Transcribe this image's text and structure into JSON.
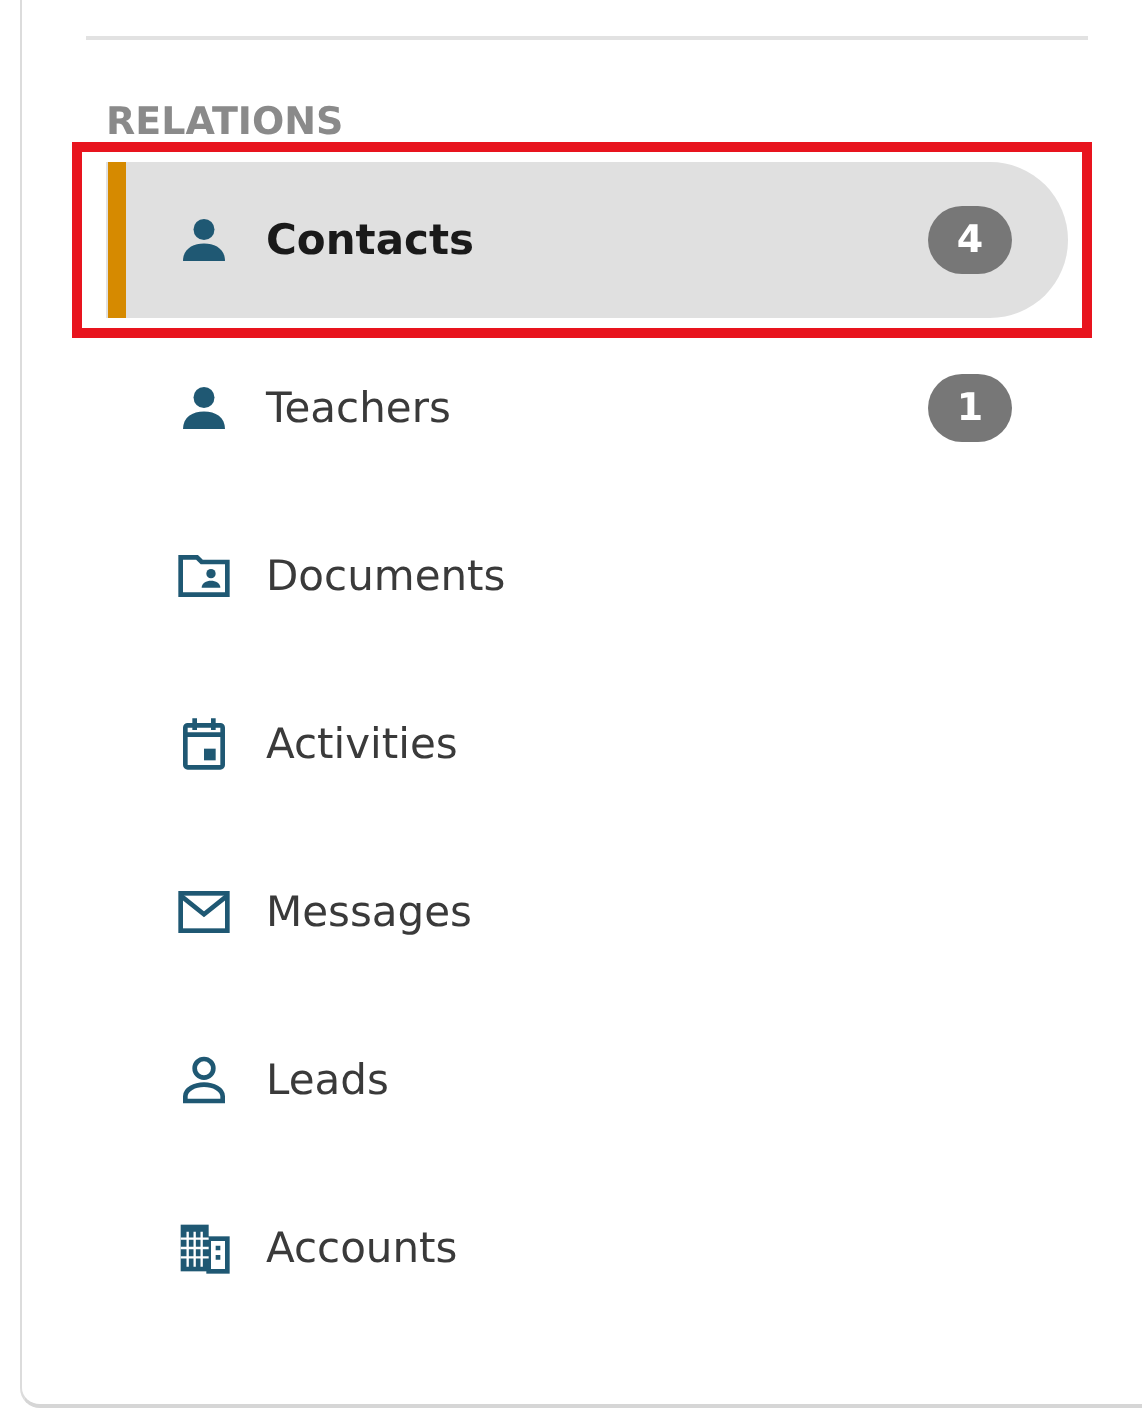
{
  "section": {
    "title": "RELATIONS"
  },
  "items": [
    {
      "label": "Contacts",
      "badge": "4",
      "selected": true
    },
    {
      "label": "Teachers",
      "badge": "1",
      "selected": false
    },
    {
      "label": "Documents",
      "selected": false
    },
    {
      "label": "Activities",
      "selected": false
    },
    {
      "label": "Messages",
      "selected": false
    },
    {
      "label": "Leads",
      "selected": false
    },
    {
      "label": "Accounts",
      "selected": false
    }
  ]
}
